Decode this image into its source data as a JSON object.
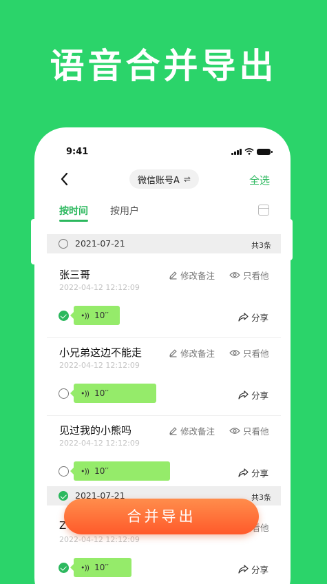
{
  "headline": "语音合并导出",
  "status": {
    "time": "9:41"
  },
  "nav": {
    "back_icon": "chevron-left",
    "account_label": "微信账号A",
    "switch_icon": "⇌",
    "select_all": "全选"
  },
  "tabs": [
    {
      "label": "按时间",
      "active": true
    },
    {
      "label": "按用户",
      "active": false
    }
  ],
  "groups": [
    {
      "date": "2021-07-21",
      "count": "共3条",
      "checked": false
    },
    {
      "date": "2021-07-21",
      "count": "共3条",
      "checked": true
    }
  ],
  "actions": {
    "edit_note": "修改备注",
    "view_only": "只看他",
    "share": "分享"
  },
  "items": [
    {
      "name": "张三哥",
      "timestamp": "2022-04-12 12:12:09",
      "duration": "10′′",
      "checked": true
    },
    {
      "name": "小兄弟这边不能走",
      "timestamp": "2022-04-12 12:12:09",
      "duration": "10′′",
      "checked": false
    },
    {
      "name": "见过我的小熊吗",
      "timestamp": "2022-04-12 12:12:09",
      "duration": "10′′",
      "checked": false
    },
    {
      "name": "Z",
      "timestamp": "2022-04-12 12:12:09",
      "duration": "10′′",
      "checked": true
    }
  ],
  "merge_button": "合并导出",
  "colors": {
    "brand_green": "#2bd46a",
    "accent_green": "#2cb85e",
    "bubble_green": "#95eb6a",
    "cta_orange": "#ff6a33"
  }
}
